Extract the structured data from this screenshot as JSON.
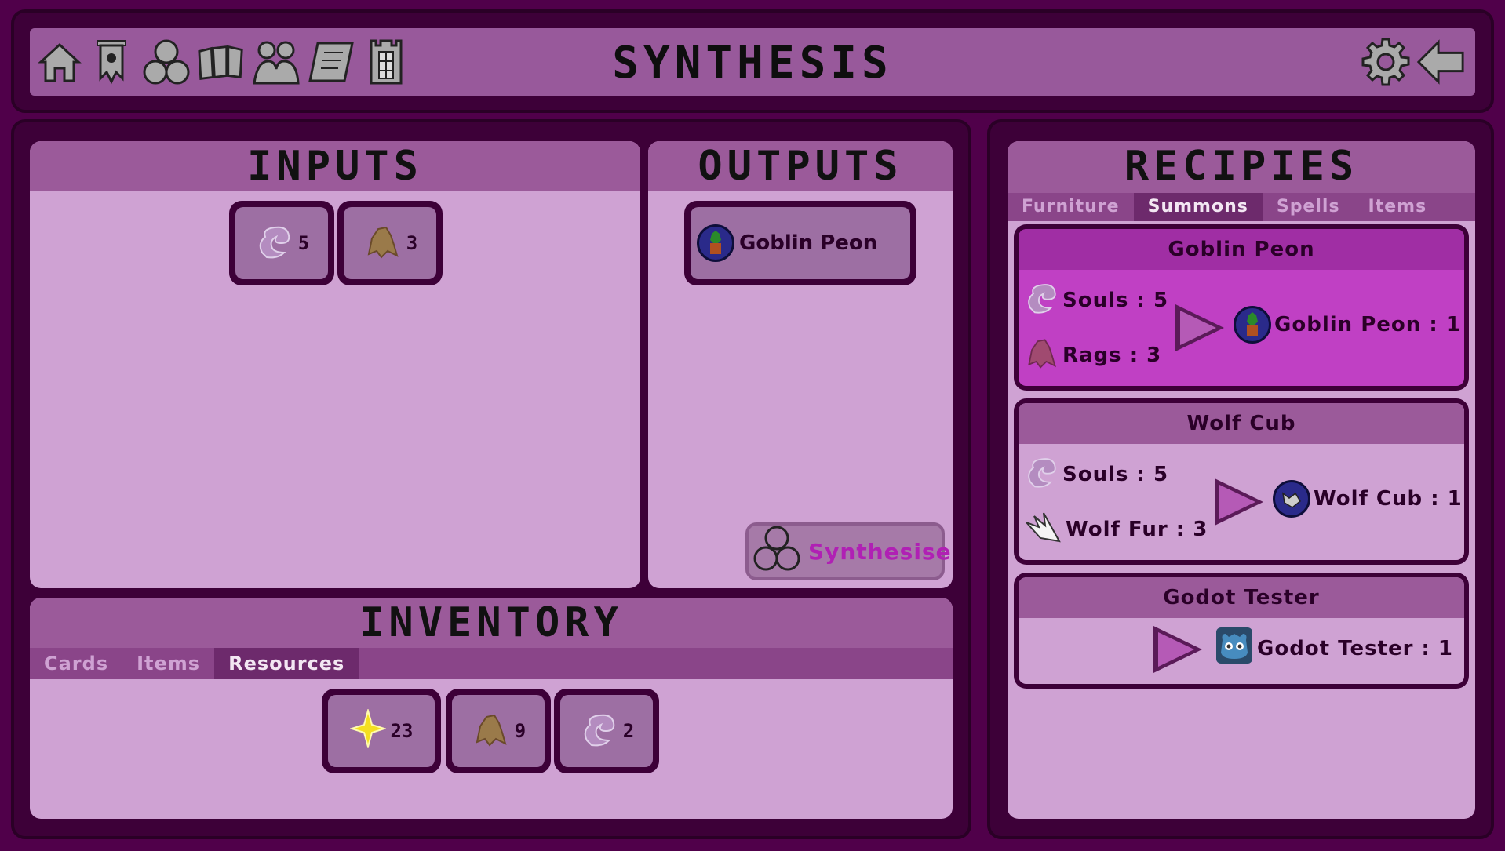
{
  "header": {
    "title": "SYNTHESIS",
    "nav_icons": [
      "home-icon",
      "banner-icon",
      "synthesis-icon",
      "cards-icon",
      "party-icon",
      "scroll-icon",
      "tower-icon"
    ],
    "right_icons": [
      "gear-icon",
      "back-arrow-icon"
    ]
  },
  "inputs": {
    "title": "INPUTS",
    "slots": [
      {
        "icon": "soul-icon",
        "count": "5"
      },
      {
        "icon": "rags-icon",
        "count": "3"
      }
    ]
  },
  "outputs": {
    "title": "OUTPUTS",
    "slots": [
      {
        "icon": "goblin-peon-icon",
        "label": "Goblin Peon"
      }
    ],
    "synthesise_label": "Synthesise"
  },
  "inventory": {
    "title": "INVENTORY",
    "tabs": [
      "Cards",
      "Items",
      "Resources"
    ],
    "active_tab": "Resources",
    "slots": [
      {
        "icon": "sparkle-icon",
        "count": "23"
      },
      {
        "icon": "rags-icon",
        "count": "9"
      },
      {
        "icon": "soul-icon",
        "count": "2"
      }
    ]
  },
  "recipes": {
    "title": "RECIPIES",
    "tabs": [
      "Furniture",
      "Summons",
      "Spells",
      "Items"
    ],
    "active_tab": "Summons",
    "cards": [
      {
        "name": "Goblin Peon",
        "ingredients": [
          {
            "icon": "soul-icon",
            "text": "Souls : 5"
          },
          {
            "icon": "rags-icon",
            "text": "Rags : 3"
          }
        ],
        "result": {
          "icon": "goblin-peon-icon",
          "text": "Goblin Peon : 1"
        },
        "selected": true
      },
      {
        "name": "Wolf Cub",
        "ingredients": [
          {
            "icon": "soul-icon",
            "text": "Souls : 5"
          },
          {
            "icon": "wolf-fur-icon",
            "text": "Wolf Fur : 3"
          }
        ],
        "result": {
          "icon": "wolf-cub-icon",
          "text": "Wolf Cub : 1"
        },
        "selected": false
      },
      {
        "name": "Godot Tester",
        "ingredients": [],
        "result": {
          "icon": "godot-icon",
          "text": "Godot Tester : 1"
        },
        "selected": false
      }
    ]
  },
  "colors": {
    "background": "#50004a",
    "panel": "#cfa2d3",
    "header": "#9b5a9a",
    "selected_recipe": "#c040c4",
    "synthesise_text": "#b020b4"
  }
}
